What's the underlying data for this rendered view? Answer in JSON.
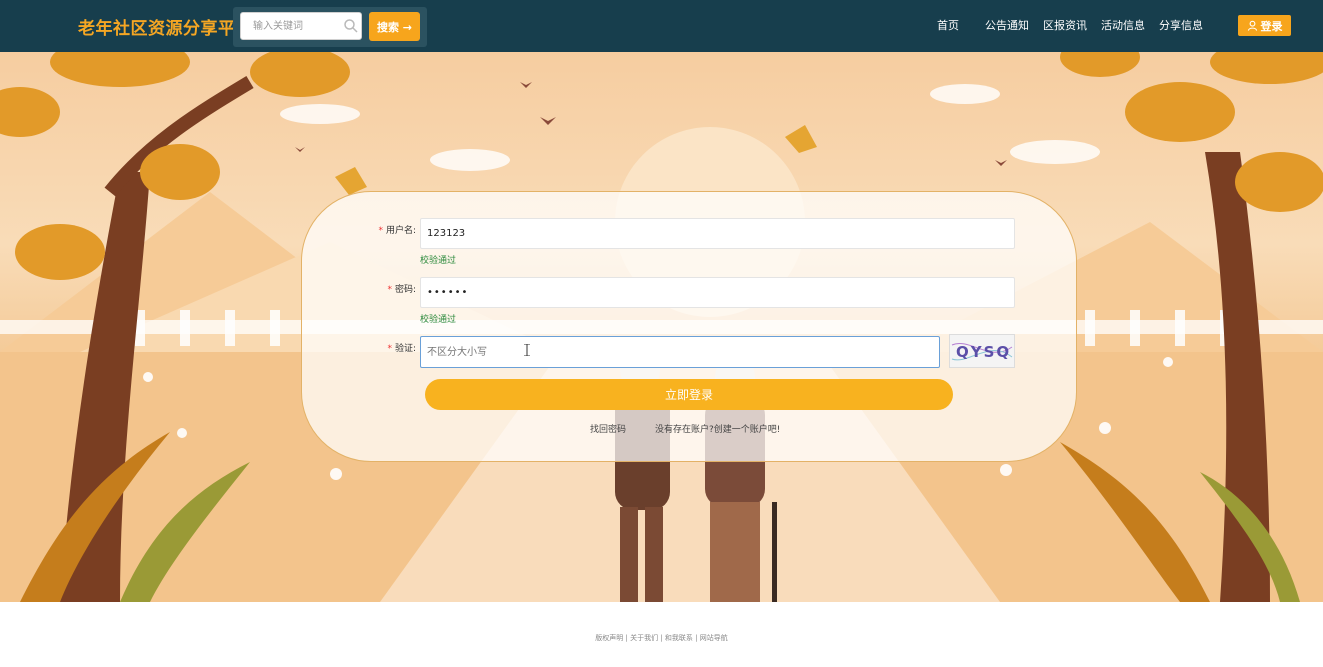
{
  "header": {
    "brand": "老年社区资源分享平台",
    "search_placeholder": "输入关键词",
    "search_button": "搜索 →",
    "nav": [
      "首页",
      "公告通知",
      "区报资讯",
      "活动信息",
      "分享信息"
    ],
    "login_button": "登录"
  },
  "form": {
    "username_label": "用户名:",
    "username_value": "123123",
    "username_valid": "校验通过",
    "password_label": "密码:",
    "password_value": "••••••",
    "password_valid": "校验通过",
    "captcha_label": "验证:",
    "captcha_placeholder": "不区分大小写",
    "captcha_text": "QYSQ",
    "submit": "立即登录",
    "forgot_link": "找回密码",
    "register_link": "没有存在账户?创建一个账户吧!"
  },
  "footer": {
    "links": [
      "版权声明",
      "关于我们",
      "和我联系",
      "网站导航"
    ],
    "separator": " | "
  },
  "colors": {
    "header_bg": "#173e4d",
    "accent": "#f7a51c",
    "brand_text": "#f5a623",
    "valid_text": "#2e8b3e"
  }
}
